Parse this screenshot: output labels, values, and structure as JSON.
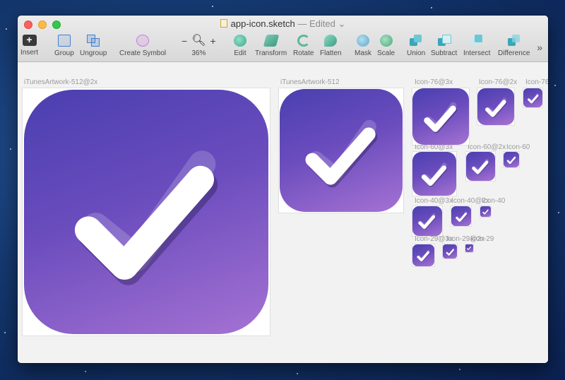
{
  "window": {
    "title": "app-icon.sketch",
    "status": "— Edited"
  },
  "toolbar": {
    "insert": "Insert",
    "group": "Group",
    "ungroup": "Ungroup",
    "create_symbol": "Create Symbol",
    "zoom_minus": "−",
    "zoom_plus": "+",
    "zoom_level": "36%",
    "edit": "Edit",
    "transform": "Transform",
    "rotate": "Rotate",
    "flatten": "Flatten",
    "mask": "Mask",
    "scale": "Scale",
    "union": "Union",
    "subtract": "Subtract",
    "intersect": "Intersect",
    "difference": "Difference",
    "more": "»"
  },
  "artboards": [
    {
      "name": "iTunesArtwork-512@2x"
    },
    {
      "name": "iTunesArtwork-512"
    },
    {
      "name": "Icon-76@3x"
    },
    {
      "name": "Icon-76@2x"
    },
    {
      "name": "Icon-76"
    },
    {
      "name": "Icon-60@3x"
    },
    {
      "name": "Icon-60@2x"
    },
    {
      "name": "Icon-60"
    },
    {
      "name": "Icon-40@3x"
    },
    {
      "name": "Icon-40@2x"
    },
    {
      "name": "Icon-40"
    },
    {
      "name": "Icon-29@3x"
    },
    {
      "name": "Icon-29@2x"
    },
    {
      "name": "Icon-29"
    }
  ],
  "colors": {
    "icon_gradient_start": "#4a3fb0",
    "icon_gradient_end": "#a572d3",
    "checkmark": "#ffffff"
  },
  "icon_semantic": "checkmark-icon"
}
